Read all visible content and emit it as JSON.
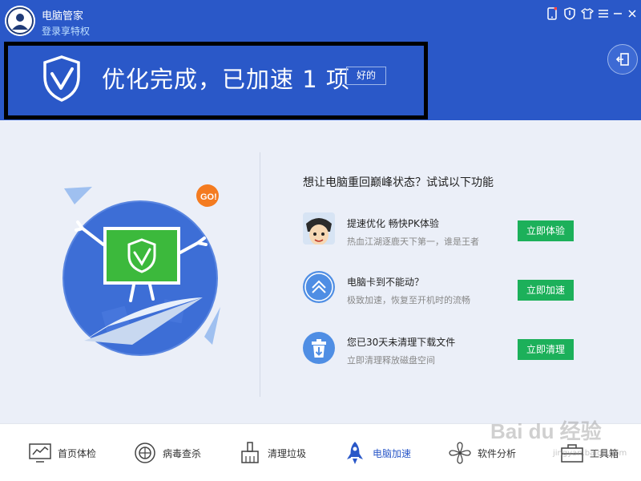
{
  "header": {
    "app_title": "电脑管家",
    "login_link": "登录享特权",
    "result_text": "优化完成，已加速 1 项",
    "ok_button": "好的",
    "top_icons": [
      "phone-icon",
      "shield-icon",
      "shirt-icon",
      "menu-icon",
      "minimize-icon",
      "close-icon"
    ]
  },
  "main": {
    "promo_heading": "想让电脑重回巅峰状态？试试以下功能",
    "bubble_text": "GO!",
    "promos": [
      {
        "title": "提速优化 畅快PK体验",
        "subtitle": "热血江湖逐鹿天下第一，谁是王者",
        "button": "立即体验",
        "icon": "game-character-icon"
      },
      {
        "title": "电脑卡到不能动？",
        "subtitle": "极致加速，恢复至开机时的流畅",
        "button": "立即加速",
        "icon": "speedup-icon"
      },
      {
        "title": "您已30天未清理下载文件",
        "subtitle": "立即清理释放磁盘空间",
        "button": "立即清理",
        "icon": "trash-icon"
      }
    ]
  },
  "bottom_nav": {
    "items": [
      {
        "label": "首页体检",
        "icon": "checkup-icon"
      },
      {
        "label": "病毒查杀",
        "icon": "virus-scan-icon"
      },
      {
        "label": "清理垃圾",
        "icon": "broom-icon"
      },
      {
        "label": "电脑加速",
        "icon": "rocket-icon",
        "active": true
      },
      {
        "label": "软件分析",
        "icon": "fan-icon"
      },
      {
        "label": "工具箱",
        "icon": "toolbox-icon"
      }
    ]
  },
  "watermark": {
    "main": "Bai du 经验",
    "sub": "jingyan.baidu.com"
  },
  "colors": {
    "header_blue": "#2a58c8",
    "main_bg": "#ebeff8",
    "green": "#1cb05a",
    "active_blue": "#2a58c8"
  }
}
